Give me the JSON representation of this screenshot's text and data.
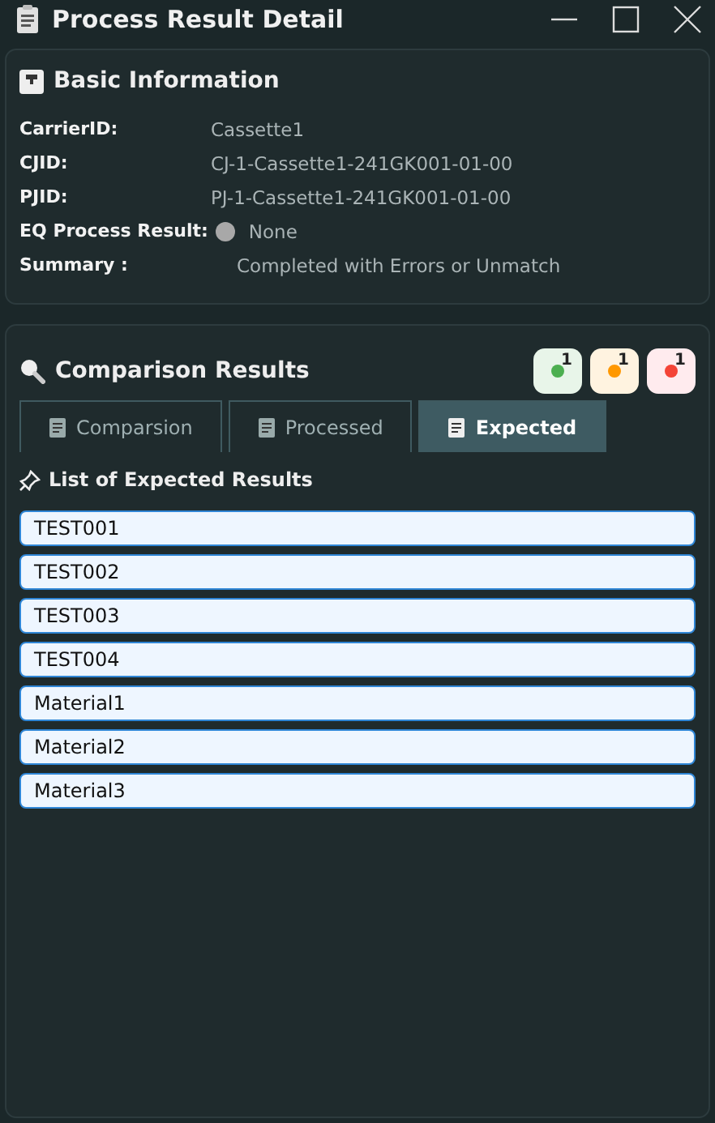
{
  "window": {
    "title": "Process Result Detail"
  },
  "basic_info": {
    "title": "Basic Information",
    "fields": [
      {
        "label": "CarrierID:",
        "value": "Cassette1",
        "kind": "text"
      },
      {
        "label": "CJID:",
        "value": "CJ-1-Cassette1-241GK001-01-00",
        "kind": "text"
      },
      {
        "label": "PJID:",
        "value": "PJ-1-Cassette1-241GK001-01-00",
        "kind": "text"
      },
      {
        "label": "EQ Process Result:",
        "value": "None",
        "kind": "status",
        "color": "#a8a8a8"
      },
      {
        "label": "Summary :",
        "value": "Completed with Errors or Unmatch",
        "kind": "summary"
      }
    ]
  },
  "comparison": {
    "title": "Comparison Results",
    "badges": [
      {
        "count": "1",
        "color": "#4caf50"
      },
      {
        "count": "1",
        "color": "#ff9800"
      },
      {
        "count": "1",
        "color": "#f44336"
      }
    ],
    "tabs": [
      {
        "label": "Comparsion",
        "selected": false
      },
      {
        "label": "Processed",
        "selected": false
      },
      {
        "label": "Expected",
        "selected": true
      }
    ],
    "list_title": "List of Expected Results",
    "items": [
      "TEST001",
      "TEST002",
      "TEST003",
      "TEST004",
      "Material1",
      "Material2",
      "Material3"
    ]
  }
}
